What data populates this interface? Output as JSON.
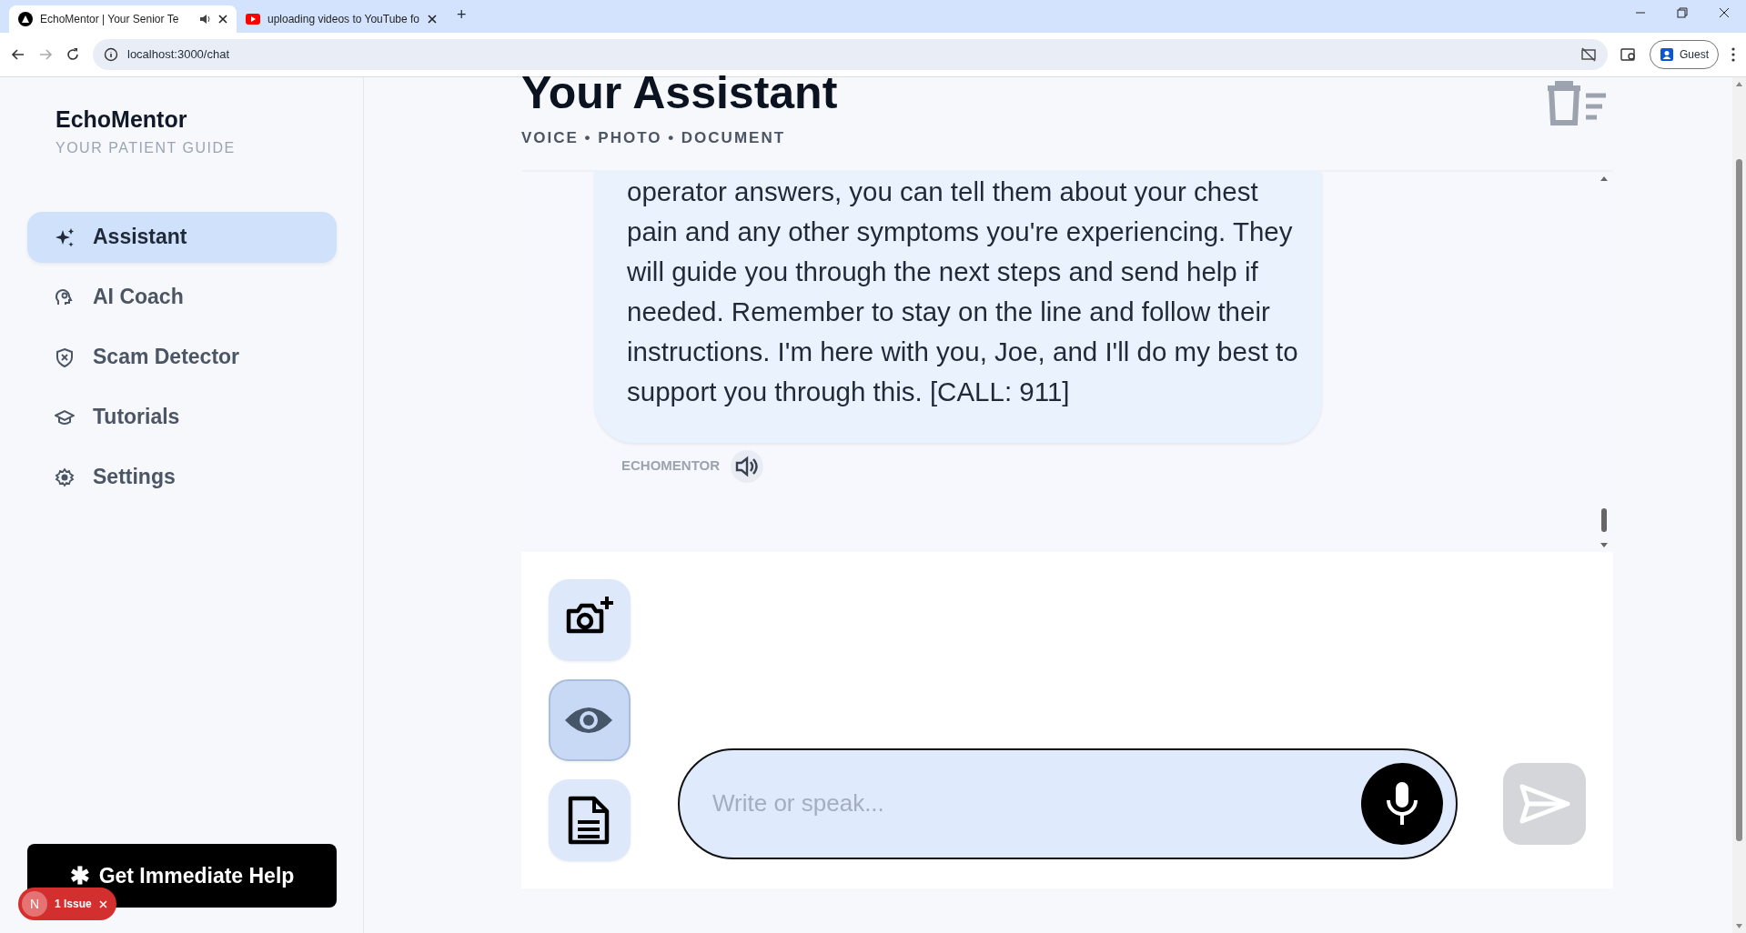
{
  "browser": {
    "tabs": [
      {
        "title": "EchoMentor | Your Senior Te",
        "selected": true,
        "audio": true
      },
      {
        "title": "uploading videos to YouTube fo",
        "selected": false,
        "audio": false
      }
    ],
    "new_tab": "+",
    "address": "localhost:3000/chat",
    "profile": "Guest"
  },
  "sidebar": {
    "brand": "EchoMentor",
    "tagline": "YOUR PATIENT GUIDE",
    "items": [
      {
        "label": "Assistant",
        "kind": "sparkle",
        "selected": true
      },
      {
        "label": "AI Coach",
        "kind": "coach",
        "selected": false
      },
      {
        "label": "Scam Detector",
        "kind": "shield",
        "selected": false
      },
      {
        "label": "Tutorials",
        "kind": "cap",
        "selected": false
      },
      {
        "label": "Settings",
        "kind": "gear",
        "selected": false
      }
    ],
    "help_button": {
      "icon": "✱",
      "label": "Get Immediate Help"
    }
  },
  "issue_badge": {
    "letter": "N",
    "label": "1 Issue"
  },
  "header": {
    "title": "Your Assistant",
    "subtitle": "VOICE • PHOTO • DOCUMENT"
  },
  "message": {
    "text": "operator answers, you can tell them about your chest pain and any other symptoms you're experiencing. They will guide you through the next steps and send help if needed. Remember to stay on the line and follow their instructions. I'm here with you, Joe, and I'll do my best to support you through this. [CALL: 911]",
    "sender": "ECHOMENTOR"
  },
  "composer": {
    "tools": [
      {
        "kind": "camera",
        "selected": false
      },
      {
        "kind": "eye",
        "selected": true
      },
      {
        "kind": "document",
        "selected": false
      }
    ],
    "placeholder": "Write or speak...",
    "send_disabled": true
  }
}
